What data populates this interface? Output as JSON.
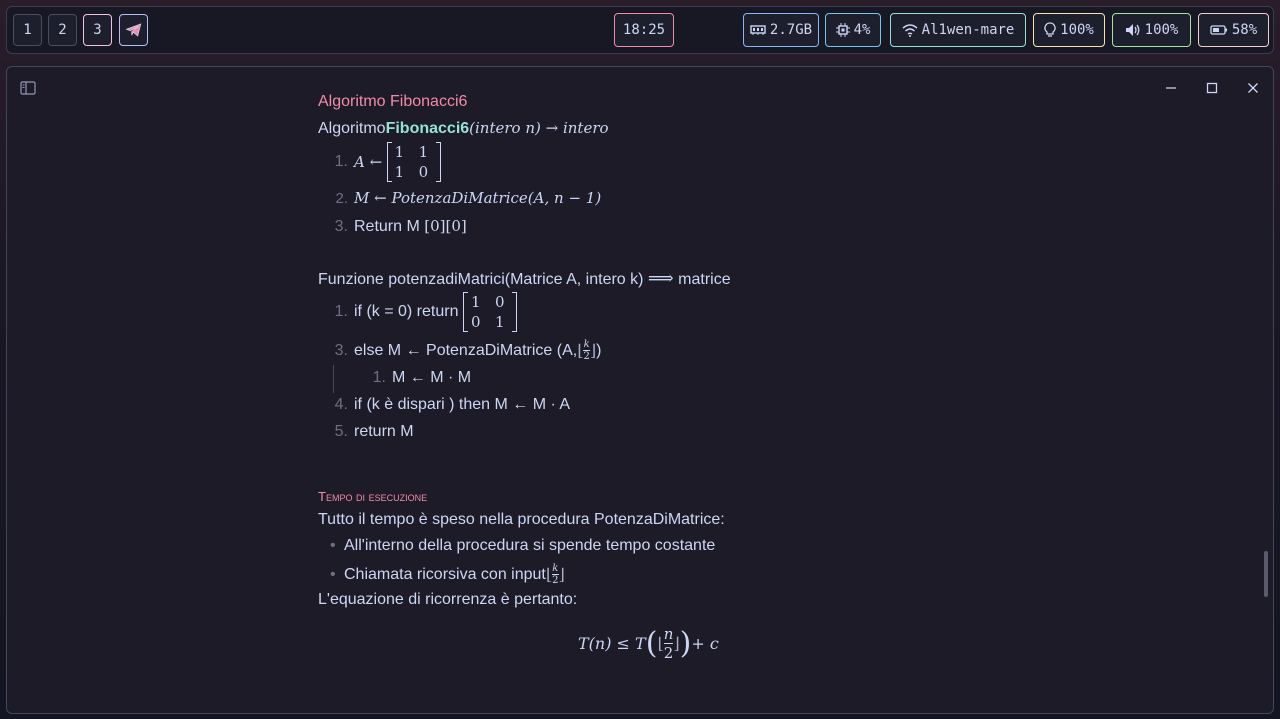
{
  "topbar": {
    "workspaces": [
      "1",
      "2",
      "3"
    ],
    "active_workspace": "3",
    "clock": "18:25",
    "memory": "2.7GB",
    "cpu": "4%",
    "wifi": "Al1wen-mare",
    "brightness": "100%",
    "volume": "100%",
    "battery": "58%"
  },
  "colors": {
    "accent_pink": "#f38ba8",
    "accent_teal": "#94e2d5",
    "memory_border": "#89b4fa",
    "cpu_border": "#74c7ec",
    "wifi_border": "#94e2d5",
    "brightness_border": "#f9e2af",
    "volume_border": "#a6e3a1",
    "battery_border": "#f2cdcd"
  },
  "doc": {
    "algo_heading": "Algoritmo Fibonacci6",
    "sig_prefix": "Algoritmo",
    "sig_name": "Fibonacci6",
    "sig_args": "(intero n) → intero",
    "algo_steps": {
      "s1_num": "1.",
      "s1_lhs": "A ←",
      "s1_matrix": [
        "1",
        "1",
        "1",
        "0"
      ],
      "s2_num": "2.",
      "s2_text": "M ← PotenzaDiMatrice(A, n − 1)",
      "s3_num": "3.",
      "s3_text": "Return M ",
      "s3_idx": "[0][0]"
    },
    "func_heading": "Funzione potenzadiMatrici(Matrice A, intero k) ",
    "func_arrow": "⟹",
    "func_ret": " matrice",
    "func_steps": {
      "f1_num": "1.",
      "f1_text": "if (k = 0) return ",
      "f1_matrix": [
        "1",
        "0",
        "0",
        "1"
      ],
      "f3_num": "3.",
      "f3_text": "else M ← PotenzaDiMatrice (A, ",
      "f3_frac_num": "k",
      "f3_frac_den": "2",
      "f3_close": ")",
      "f3a_num": "1.",
      "f3a_text": "M ← M · M",
      "f4_num": "4.",
      "f4_text": "if (k è dispari ) then M ← M · A",
      "f5_num": "5.",
      "f5_text": "return M"
    },
    "section_title": "Tempo di esecuzione",
    "p1": "Tutto il tempo è speso nella procedura PotenzaDiMatrice:",
    "bullet1": "All'interno della procedura si spende tempo costante",
    "bullet2": "Chiamata ricorsiva con input ",
    "bullet2_frac_num": "k",
    "bullet2_frac_den": "2",
    "p2": "L'equazione di ricorrenza è pertanto:",
    "eq_left": "T(n) ≤ T ",
    "eq_frac_num": "n",
    "eq_frac_den": "2",
    "eq_right": " + c"
  }
}
